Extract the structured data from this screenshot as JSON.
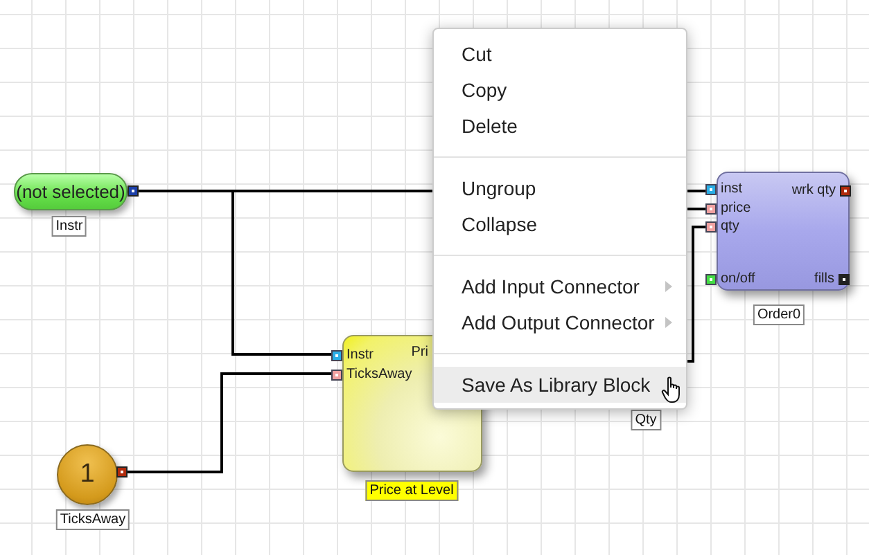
{
  "nodes": [
    {
      "kind": "pill",
      "text": "(not selected)",
      "caption": "Instr",
      "selected": false,
      "ports": [
        {
          "kind": "output",
          "color": "#1c3fa8"
        }
      ]
    },
    {
      "kind": "circle",
      "text": "1",
      "caption": "TicksAway",
      "selected": false,
      "ports": [
        {
          "kind": "output",
          "color": "#b02a0c"
        }
      ]
    },
    {
      "kind": "block",
      "caption": "Price at Level",
      "selected": true,
      "ports": [
        {
          "kind": "input",
          "label": "Instr",
          "color": "#2aaee6"
        },
        {
          "kind": "input",
          "label": "TicksAway",
          "color": "#f0a0a0"
        },
        {
          "kind": "output",
          "label": "Pri"
        }
      ]
    },
    {
      "kind": "order",
      "caption": "Order0",
      "selected": false,
      "ports": [
        {
          "kind": "input",
          "label": "inst",
          "color": "#2aaee6"
        },
        {
          "kind": "input",
          "label": "price",
          "color": "#f0a0a0"
        },
        {
          "kind": "input",
          "label": "qty",
          "color": "#f0a0a0"
        },
        {
          "kind": "input",
          "label": "on/off",
          "color": "#44dd44"
        },
        {
          "kind": "output",
          "label": "wrk qty",
          "color": "#b02a0c"
        },
        {
          "kind": "output",
          "label": "fills",
          "color": "#222222"
        }
      ]
    }
  ],
  "other_labels": [
    {
      "text": "Qty"
    }
  ],
  "context_menu": [
    {
      "kind": "item",
      "label": "Cut",
      "submenu": false,
      "selected": false
    },
    {
      "kind": "item",
      "label": "Copy",
      "submenu": false,
      "selected": false
    },
    {
      "kind": "item",
      "label": "Delete",
      "submenu": false,
      "selected": false
    },
    {
      "kind": "separator"
    },
    {
      "kind": "item",
      "label": "Ungroup",
      "submenu": false,
      "selected": false
    },
    {
      "kind": "item",
      "label": "Collapse",
      "submenu": false,
      "selected": false
    },
    {
      "kind": "separator"
    },
    {
      "kind": "item",
      "label": "Add Input Connector",
      "submenu": true,
      "selected": false
    },
    {
      "kind": "item",
      "label": "Add Output Connector",
      "submenu": true,
      "selected": false
    },
    {
      "kind": "separator"
    },
    {
      "kind": "item",
      "label": "Save As Library Block",
      "submenu": false,
      "selected": true
    }
  ]
}
